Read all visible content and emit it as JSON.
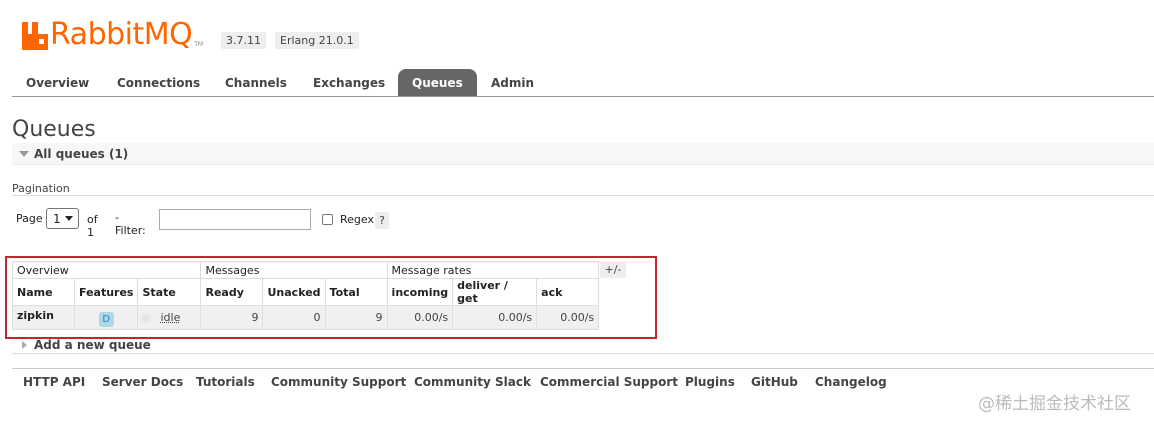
{
  "header": {
    "logo_text": "RabbitMQ",
    "logo_tm": "TM",
    "brand_color": "#ff6600",
    "version": "3.7.11",
    "erlang": "Erlang 21.0.1"
  },
  "tabs": [
    {
      "label": "Overview",
      "active": false
    },
    {
      "label": "Connections",
      "active": false
    },
    {
      "label": "Channels",
      "active": false
    },
    {
      "label": "Exchanges",
      "active": false
    },
    {
      "label": "Queues",
      "active": true
    },
    {
      "label": "Admin",
      "active": false
    }
  ],
  "main": {
    "title": "Queues",
    "all_queues_label": "All queues (1)",
    "pagination_label": "Pagination",
    "page_label": "Page",
    "page_value": "1",
    "of_label": "of 1",
    "filter_label": "- Filter:",
    "filter_value": "",
    "regex_label": "Regex",
    "regex_checked": false,
    "help_label": "?",
    "plus_minus": "+/-",
    "add_queue_label": "Add a new queue",
    "highlight_color": "#c0282d"
  },
  "table": {
    "groups": [
      "Overview",
      "Messages",
      "Message rates"
    ],
    "columns": [
      "Name",
      "Features",
      "State",
      "Ready",
      "Unacked",
      "Total",
      "incoming",
      "deliver / get",
      "ack"
    ],
    "rows": [
      {
        "name": "zipkin",
        "features": "D",
        "state": "idle",
        "ready": "9",
        "unacked": "0",
        "total": "9",
        "incoming": "0.00/s",
        "deliver_get": "0.00/s",
        "ack": "0.00/s"
      }
    ]
  },
  "footer": {
    "links": [
      "HTTP API",
      "Server Docs",
      "Tutorials",
      "Community Support",
      "Community Slack",
      "Commercial Support",
      "Plugins",
      "GitHub",
      "Changelog"
    ]
  },
  "watermark": "@稀土掘金技术社区"
}
